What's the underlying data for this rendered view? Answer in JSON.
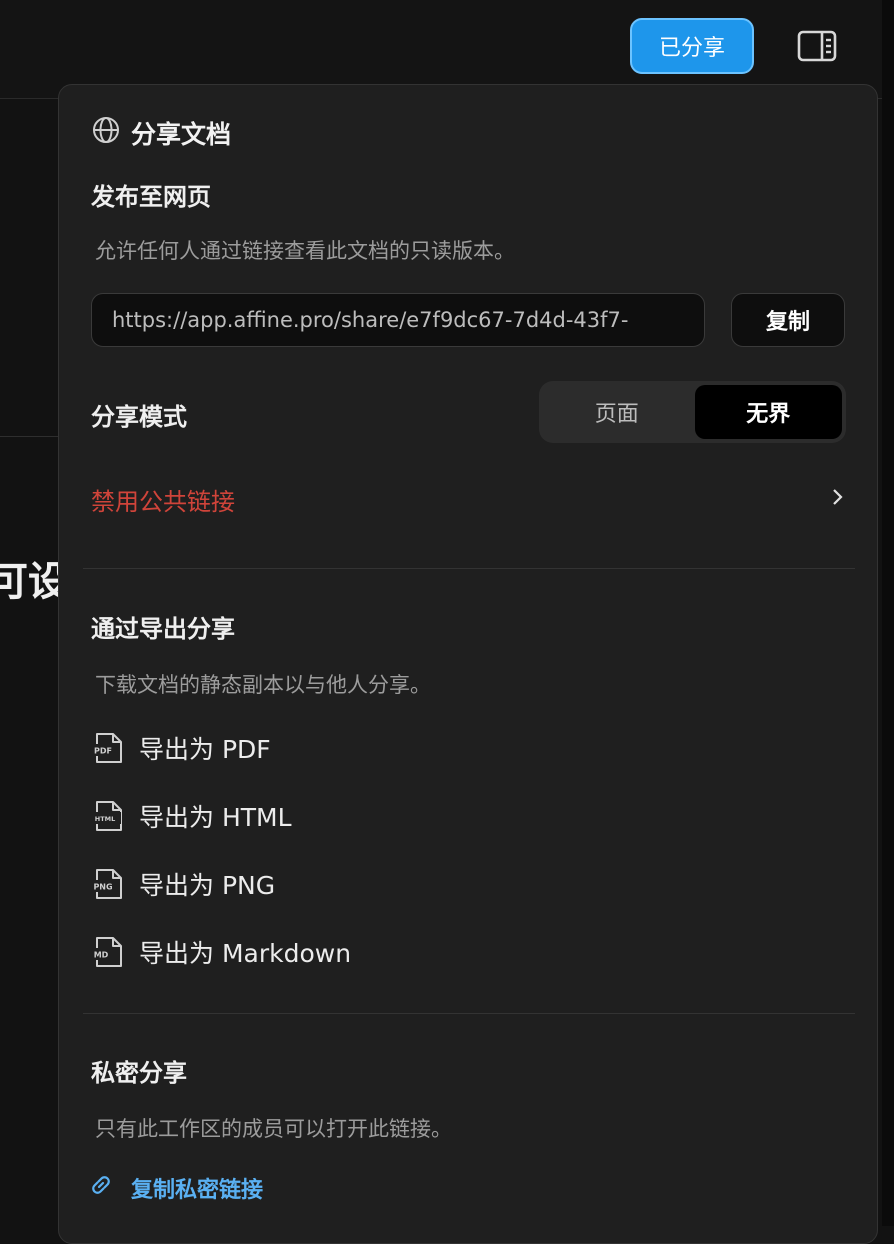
{
  "topbar": {
    "shared_label": "已分享",
    "sidebar_icon": "sidebar-toggle-icon"
  },
  "background": {
    "partial_heading": "可设"
  },
  "share_panel": {
    "header": {
      "icon": "globe-icon",
      "title": "分享文档"
    },
    "publish": {
      "title": "发布至网页",
      "description": "允许任何人通过链接查看此文档的只读版本。",
      "url": "https://app.affine.pro/share/e7f9dc67-7d4d-43f7-",
      "copy_label": "复制"
    },
    "mode": {
      "label": "分享模式",
      "options": [
        "页面",
        "无界"
      ],
      "selected": "无界"
    },
    "disable_public_link": {
      "label": "禁用公共链接",
      "color": "#d0443a"
    },
    "export": {
      "title": "通过导出分享",
      "description": "下载文档的静态副本以与他人分享。",
      "items": [
        {
          "label": "导出为 PDF",
          "badge": "PDF"
        },
        {
          "label": "导出为 HTML",
          "badge": "HTML"
        },
        {
          "label": "导出为 PNG",
          "badge": "PNG"
        },
        {
          "label": "导出为 Markdown",
          "badge": "MD"
        }
      ]
    },
    "private": {
      "title": "私密分享",
      "description": "只有此工作区的成员可以打开此链接。",
      "link_label": "复制私密链接",
      "link_icon": "link-icon"
    }
  }
}
